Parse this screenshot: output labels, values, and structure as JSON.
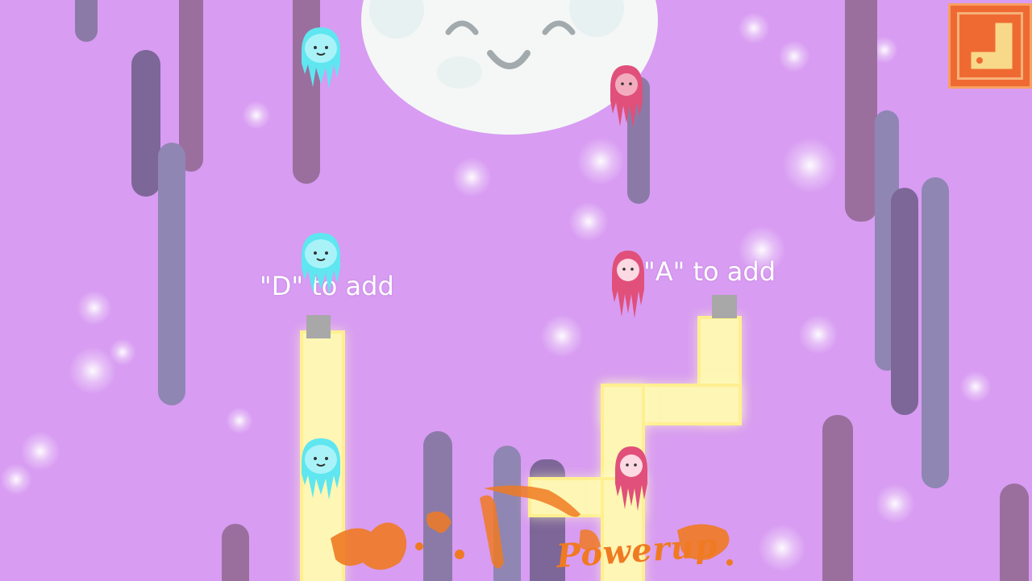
{
  "game": {
    "hints": {
      "left": "\"D\" to add",
      "right": "\"A\" to add"
    },
    "powerup_label": "Powerup"
  },
  "colors": {
    "background": "#d89cf2",
    "pipe": "#fdf6b4",
    "blue_spirit": "#5fe6f0",
    "red_spirit": "#e0507a",
    "menu_button": "#ef6a32",
    "moon": "#f4f7f6",
    "splash": "#f07a22"
  },
  "icons": {
    "menu_button": "pipe-menu-icon",
    "moon": "smiling-moon-icon",
    "blue_spirit": "blue-ghost-icon",
    "red_spirit": "red-ghost-icon"
  }
}
